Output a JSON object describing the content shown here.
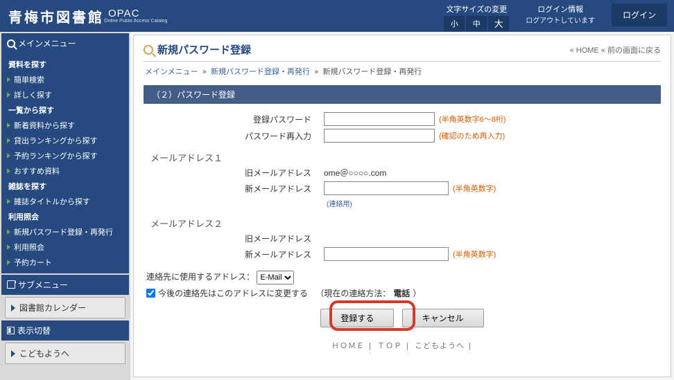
{
  "header": {
    "logo": "青梅市図書館",
    "opac": "OPAC",
    "opac_sub": "Online Public Access Catalog",
    "size_label": "文字サイズの変更",
    "size_small": "小",
    "size_mid": "中",
    "size_large": "大",
    "login_title": "ログイン情報",
    "login_status": "ログアウトしています",
    "login_btn": "ログイン"
  },
  "sidebar": {
    "main_title": "メインメニュー",
    "g1_title": "資料を探す",
    "g1_items": [
      "簡単検索",
      "詳しく探す"
    ],
    "g2_title": "一覧から探す",
    "g2_items": [
      "新着資料から探す",
      "貸出ランキングから探す",
      "予約ランキングから探す",
      "おすすめ資料"
    ],
    "g3_title": "雑誌を探す",
    "g3_items": [
      "雑誌タイトルから探す"
    ],
    "g4_title": "利用照会",
    "g4_items": [
      "新規パスワード登録・再発行",
      "利用照会",
      "予約カート"
    ],
    "sub_title": "サブメニュー",
    "calendar": "図書館カレンダー",
    "toggle_title": "表示切替",
    "kids": "こどもようへ"
  },
  "main": {
    "title": "新規パスワード登録",
    "link_home": "HOME",
    "link_back": "前の画面に戻る",
    "bc_main": "メインメニュー",
    "bc_link": "新規パスワード登録・再発行",
    "bc_cur": "新規パスワード登録・再発行",
    "section": "（２）パスワード登録",
    "pw_label": "登録パスワード",
    "pw_hint": "(半角英数字6～8桁)",
    "pw2_label": "パスワード再入力",
    "pw2_hint": "(確認のため再入力)",
    "mail1": "メールアドレス１",
    "old_mail": "旧メールアドレス",
    "old_mail_val": "ome＠○○○○.com",
    "new_mail": "新メールアドレス",
    "mail_hint": "(半角英数字)",
    "mail_note": "(連絡用)",
    "mail2": "メールアドレス２",
    "contact_label": "連絡先に使用するアドレス：",
    "contact_opt": "E-Mail",
    "chg_label": "今後の連絡先はこのアドレスに変更する",
    "chg_cur": "（現在の連絡方法：",
    "chg_val": "電話",
    "chg_end": "）",
    "submit": "登録する",
    "cancel": "キャンセル",
    "f_home": "ＨＯＭＥ",
    "f_top": "ＴＯＰ",
    "f_kids": "こどもようへ"
  }
}
